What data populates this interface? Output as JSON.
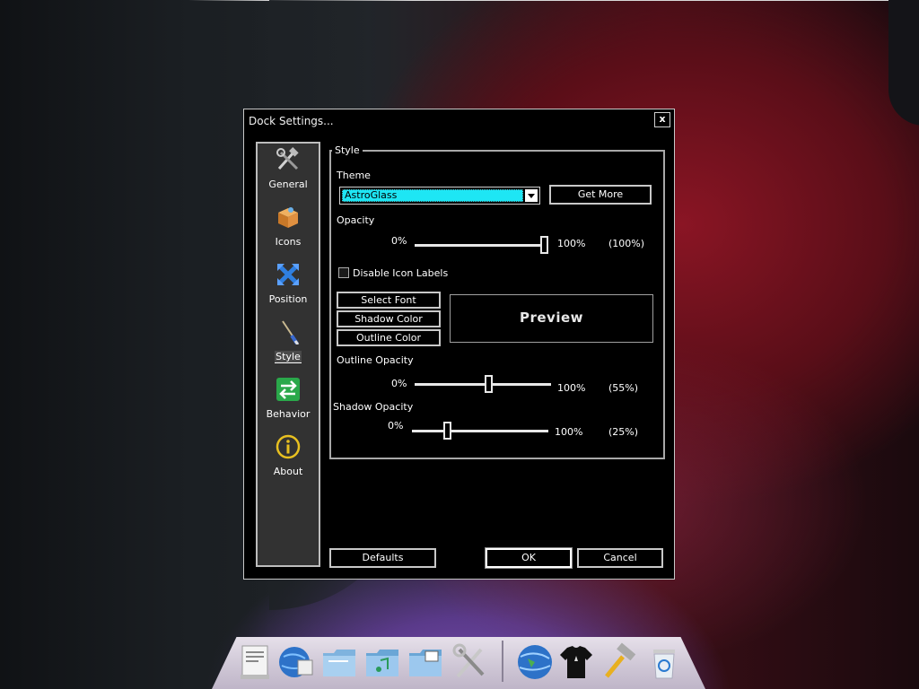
{
  "dialog": {
    "title": "Dock Settings...",
    "close_label": "x"
  },
  "sidebar": {
    "items": [
      {
        "label": "General",
        "icon": "tools-icon"
      },
      {
        "label": "Icons",
        "icon": "box-icon"
      },
      {
        "label": "Position",
        "icon": "position-arrows-icon"
      },
      {
        "label": "Style",
        "icon": "paintbrush-icon",
        "active": true
      },
      {
        "label": "Behavior",
        "icon": "swap-arrows-icon"
      },
      {
        "label": "About",
        "icon": "info-icon"
      }
    ]
  },
  "style": {
    "group_label": "Style",
    "theme_label": "Theme",
    "theme_value": "AstroGlass",
    "get_more_label": "Get More",
    "opacity_label": "Opacity",
    "opacity_min": "0%",
    "opacity_max": "100%",
    "opacity_value": "(100%)",
    "opacity_level": 1.0,
    "disable_labels_label": "Disable Icon Labels",
    "disable_labels_checked": false,
    "select_font_label": "Select Font",
    "shadow_color_label": "Shadow Color",
    "outline_color_label": "Outline Color",
    "preview_text": "Preview",
    "outline_opacity_label": "Outline Opacity",
    "outline_min": "0%",
    "outline_max": "100%",
    "outline_value": "(55%)",
    "outline_level": 0.55,
    "shadow_opacity_label": "Shadow Opacity",
    "shadow_min": "0%",
    "shadow_max": "100%",
    "shadow_value": "(25%)",
    "shadow_level": 0.25
  },
  "footer": {
    "defaults_label": "Defaults",
    "ok_label": "OK",
    "cancel_label": "Cancel"
  },
  "dock": {
    "icons": [
      "document-preview-icon",
      "globe-mail-icon",
      "folder-icon",
      "music-folder-icon",
      "pictures-folder-icon",
      "tools-icon",
      "globe-icon",
      "tshirt-icon",
      "hammer-icon",
      "recycle-bin-icon"
    ]
  },
  "colors": {
    "theme_highlight": "#1ee6f4",
    "dialog_bg": "#000000",
    "sidebar_bg": "#323232"
  }
}
